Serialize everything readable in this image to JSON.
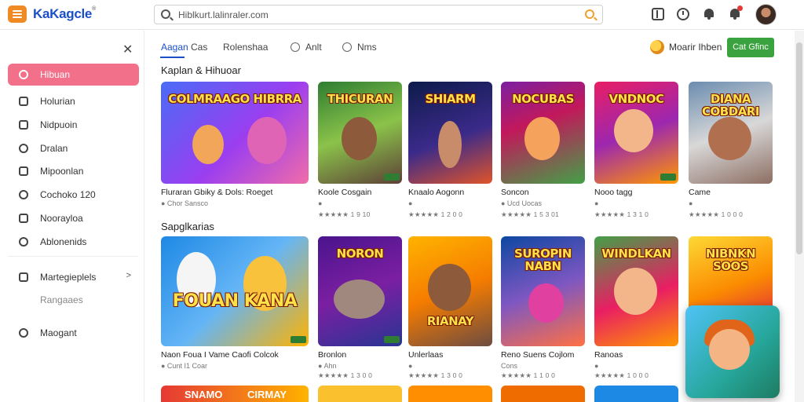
{
  "app": {
    "logo": "KaKagcle",
    "registered": "®"
  },
  "search": {
    "value": "Hiblkurt.lalinraler.com"
  },
  "sidebar": {
    "items": [
      {
        "label": "Hibuan"
      },
      {
        "label": "Holurian"
      },
      {
        "label": "Nidpuoin"
      },
      {
        "label": "Dralan"
      },
      {
        "label": "Mipoonlan"
      },
      {
        "label": "Cochoko 120"
      },
      {
        "label": "Noorayloa"
      },
      {
        "label": "Ablonenids"
      },
      {
        "label": "Martegieplels"
      },
      {
        "label": "Rangaaes"
      },
      {
        "label": "Maogant"
      }
    ]
  },
  "tabs": [
    {
      "label": "Aagan"
    },
    {
      "label": "Cas"
    },
    {
      "label": "Rolenshaa"
    },
    {
      "label": "Anlt"
    },
    {
      "label": "Nms"
    }
  ],
  "header_actions": {
    "promo_text": "Moarir Ihben",
    "cta_label": "Cat Gfinc"
  },
  "sections": [
    {
      "title": "Kaplan & Hihuoar",
      "cards": [
        {
          "caption": "COLMRAAGO HIBRRA",
          "name": "Fluraran Gbiky & Dols: Roeget",
          "meta": "● Chor Sansco",
          "rating": "★★★★★ 1 3 10"
        },
        {
          "caption": "THICURAN",
          "name": "Koole Cosgain",
          "meta": "●",
          "rating": "★★★★★ 1 9 10"
        },
        {
          "caption": "SHIARM",
          "name": "Knaalo Aogonn",
          "meta": "●",
          "rating": "★★★★★ 1 2 0 0"
        },
        {
          "caption": "NOCUBAS",
          "name": "Soncon",
          "meta": "● Ucd Uocas",
          "rating": "★★★★★ 1 5 3 01"
        },
        {
          "caption": "VNDNOC",
          "name": "Nooo tagg",
          "meta": "●",
          "rating": "★★★★★ 1 3 1 0"
        },
        {
          "caption": "DIANA COBDARI",
          "name": "Came",
          "meta": "●",
          "rating": "★★★★★ 1 0 0 0"
        }
      ]
    },
    {
      "title": "Sapglkarias",
      "cards": [
        {
          "caption": "FOUAN KANA",
          "name": "Naon Foua I Vame Caofi Colcok",
          "meta": "● Cunt I1 Coar",
          "rating": "★★★★★ 1 2 0 0"
        },
        {
          "caption": "NORON",
          "name": "Bronlon",
          "meta": "● Ahn",
          "rating": "★★★★★ 1 3 0 0"
        },
        {
          "caption": "RIANAY",
          "name": "Unlerlaas",
          "meta": "●",
          "rating": "★★★★★ 1 3 0 0"
        },
        {
          "caption": "SUROPIN NABN",
          "name": "Reno Suens Cojlom",
          "meta": "Cons",
          "rating": "★★★★★ 1 1 0 0"
        },
        {
          "caption": "WINDLKAN",
          "name": "Ranoas",
          "meta": "●",
          "rating": "★★★★★ 1 0 0 0"
        },
        {
          "caption": "NIBNKN SOOS",
          "name": "",
          "meta": "",
          "rating": ""
        }
      ]
    }
  ],
  "bottom_row": {
    "captions": [
      "SNAMO",
      "CIRMAY"
    ]
  },
  "colors": {
    "accent_blue": "#1b4fc9",
    "active_pink": "#f2708a",
    "cta_green": "#3aa340",
    "menu_orange": "#f08a24"
  }
}
